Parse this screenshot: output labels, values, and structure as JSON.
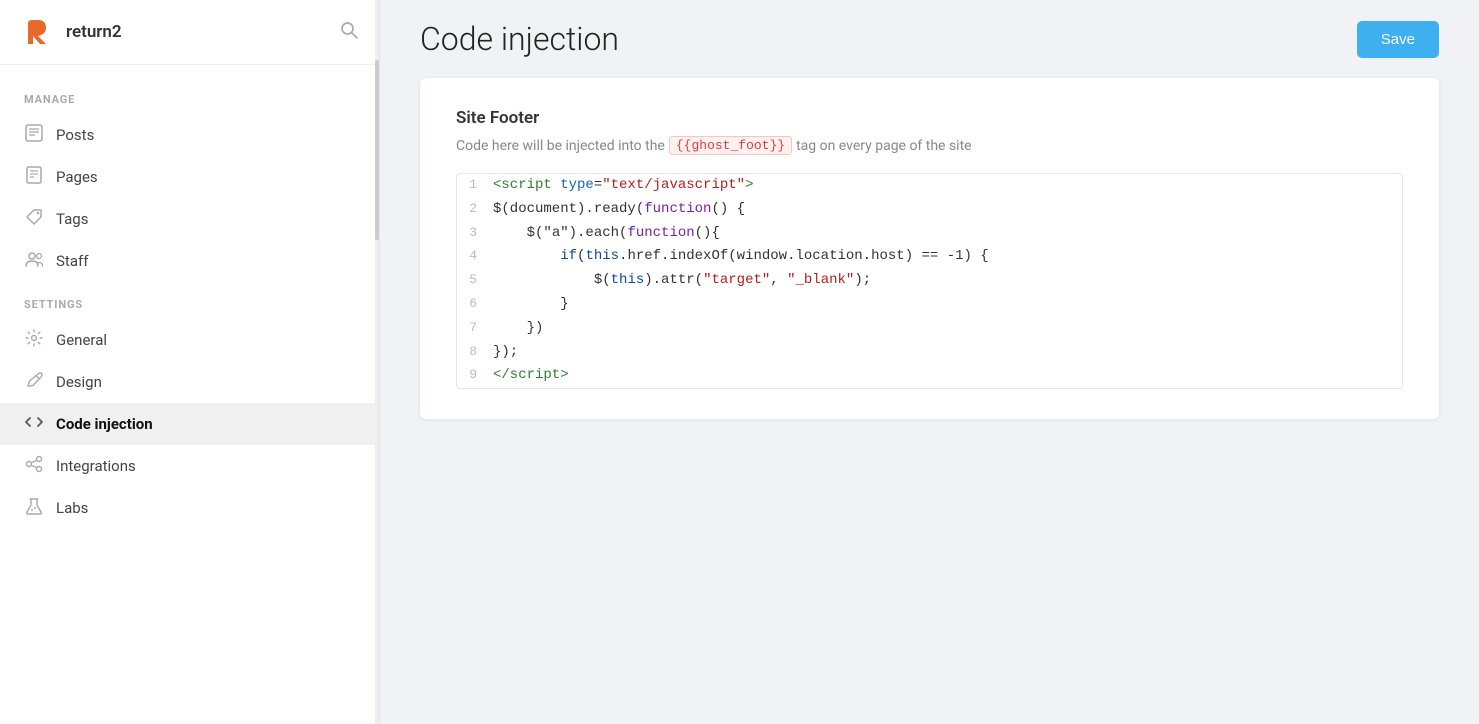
{
  "app": {
    "logo_text": "return2",
    "search_placeholder": "Search"
  },
  "sidebar": {
    "manage_label": "MANAGE",
    "settings_label": "SETTINGS",
    "manage_items": [
      {
        "id": "posts",
        "label": "Posts",
        "icon": "posts-icon"
      },
      {
        "id": "pages",
        "label": "Pages",
        "icon": "pages-icon"
      },
      {
        "id": "tags",
        "label": "Tags",
        "icon": "tags-icon"
      },
      {
        "id": "staff",
        "label": "Staff",
        "icon": "staff-icon"
      }
    ],
    "settings_items": [
      {
        "id": "general",
        "label": "General",
        "icon": "general-icon"
      },
      {
        "id": "design",
        "label": "Design",
        "icon": "design-icon"
      },
      {
        "id": "code-injection",
        "label": "Code injection",
        "icon": "code-injection-icon",
        "active": true
      },
      {
        "id": "integrations",
        "label": "Integrations",
        "icon": "integrations-icon"
      },
      {
        "id": "labs",
        "label": "Labs",
        "icon": "labs-icon"
      }
    ]
  },
  "page": {
    "title": "Code injection",
    "save_button": "Save"
  },
  "site_footer": {
    "section_title": "Site Footer",
    "description_before": "Code here will be injected into the",
    "code_tag": "{{ghost_foot}}",
    "description_after": "tag on every page of the site",
    "code_lines": [
      {
        "num": "1",
        "html": "<span class='c-tag'>&lt;script</span> <span class='c-attr'>type</span>=<span class='c-str'>\"text/javascript\"</span><span class='c-tag'>&gt;</span>"
      },
      {
        "num": "2",
        "html": "<span class='c-text'>$(document).ready(</span><span class='c-fn'>function</span><span class='c-punc'>() {</span>"
      },
      {
        "num": "3",
        "html": "    <span class='c-text'>$(\"a\").each(</span><span class='c-fn'>function</span><span class='c-punc'>(){</span>"
      },
      {
        "num": "4",
        "html": "        <span class='c-kw'>if</span><span class='c-punc'>(</span><span class='c-kw'>this</span><span class='c-text'>.href.indexOf(window.location.host) == -1) {</span>"
      },
      {
        "num": "5",
        "html": "            <span class='c-text'>$(</span><span class='c-kw'>this</span><span class='c-text'>).attr(</span><span class='c-str'>\"target\"</span><span class='c-text'>, </span><span class='c-str'>\"_blank\"</span><span class='c-text'>);</span>"
      },
      {
        "num": "6",
        "html": "        <span class='c-punc'>}</span>"
      },
      {
        "num": "7",
        "html": "    <span class='c-punc'>})</span>"
      },
      {
        "num": "8",
        "html": "<span class='c-punc'>});</span>"
      },
      {
        "num": "9",
        "html": "<span class='c-tag'>&lt;/script&gt;</span>"
      }
    ]
  }
}
